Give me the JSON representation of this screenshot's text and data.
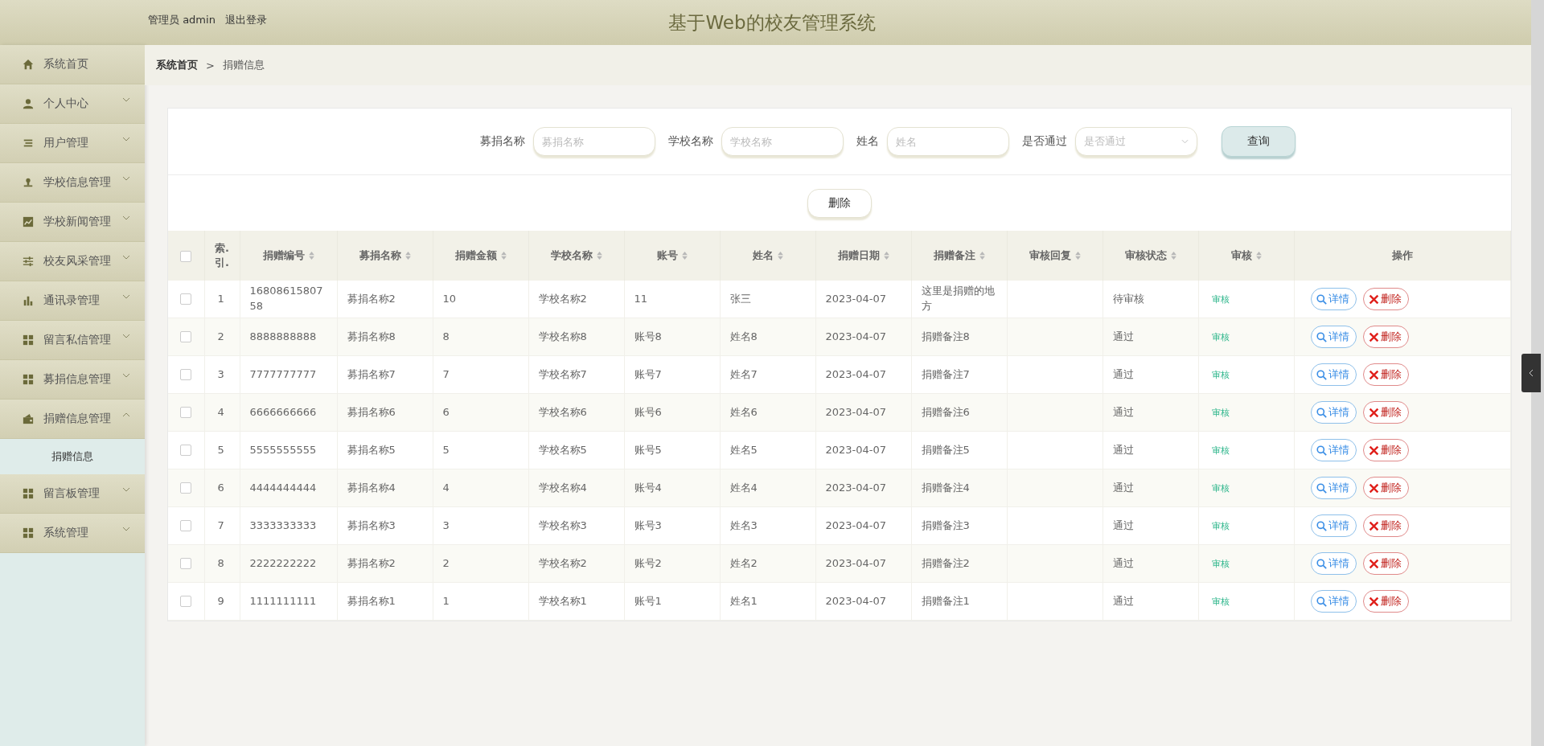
{
  "header": {
    "user_label": "管理员 admin",
    "logout": "退出登录",
    "title": "基于Web的校友管理系统"
  },
  "sidebar": {
    "items": [
      {
        "label": "系统首页"
      },
      {
        "label": "个人中心",
        "expanded": false
      },
      {
        "label": "用户管理",
        "expanded": false
      },
      {
        "label": "学校信息管理",
        "expanded": false
      },
      {
        "label": "学校新闻管理",
        "expanded": false
      },
      {
        "label": "校友风采管理",
        "expanded": false
      },
      {
        "label": "通讯录管理",
        "expanded": false
      },
      {
        "label": "留言私信管理",
        "expanded": false
      },
      {
        "label": "募捐信息管理",
        "expanded": false
      },
      {
        "label": "捐赠信息管理",
        "expanded": true,
        "children": [
          {
            "label": "捐赠信息"
          }
        ]
      },
      {
        "label": "留言板管理",
        "expanded": false
      },
      {
        "label": "系统管理",
        "expanded": false
      }
    ]
  },
  "breadcrumb": [
    "系统首页",
    ">",
    "捐赠信息"
  ],
  "search": {
    "fields": [
      {
        "label": "募捐名称",
        "placeholder": "募捐名称",
        "kind": "input"
      },
      {
        "label": "学校名称",
        "placeholder": "学校名称",
        "kind": "input"
      },
      {
        "label": "姓名",
        "placeholder": "姓名",
        "kind": "input"
      },
      {
        "label": "是否通过",
        "placeholder": "是否通过",
        "kind": "select"
      }
    ],
    "button": "查询"
  },
  "bulk_delete": "删除",
  "table": {
    "all_checked": false,
    "columns": [
      {
        "label": "索.\n引.",
        "sortable": false
      },
      {
        "label": "捐赠编号",
        "sortable": true
      },
      {
        "label": "募捐名称",
        "sortable": true
      },
      {
        "label": "捐赠金额",
        "sortable": true
      },
      {
        "label": "学校名称",
        "sortable": true
      },
      {
        "label": "账号",
        "sortable": true
      },
      {
        "label": "姓名",
        "sortable": true
      },
      {
        "label": "捐赠日期",
        "sortable": true
      },
      {
        "label": "捐赠备注",
        "sortable": true
      },
      {
        "label": "审核回复",
        "sortable": true
      },
      {
        "label": "审核状态",
        "sortable": true
      },
      {
        "label": "审核",
        "sortable": true
      },
      {
        "label": "操作",
        "sortable": false
      }
    ],
    "rows": [
      {
        "checked": false,
        "cells": [
          "1",
          "1680861580758",
          "募捐名称2",
          "10",
          "学校名称2",
          "11",
          "张三",
          "2023-04-07",
          "这里是捐赠的地方",
          "",
          "待审核"
        ],
        "review": "审核",
        "actions": [
          "详情",
          "删除"
        ]
      },
      {
        "checked": false,
        "cells": [
          "2",
          "8888888888",
          "募捐名称8",
          "8",
          "学校名称8",
          "账号8",
          "姓名8",
          "2023-04-07",
          "捐赠备注8",
          "",
          "通过"
        ],
        "review": "审核",
        "actions": [
          "详情",
          "删除"
        ]
      },
      {
        "checked": false,
        "cells": [
          "3",
          "7777777777",
          "募捐名称7",
          "7",
          "学校名称7",
          "账号7",
          "姓名7",
          "2023-04-07",
          "捐赠备注7",
          "",
          "通过"
        ],
        "review": "审核",
        "actions": [
          "详情",
          "删除"
        ]
      },
      {
        "checked": false,
        "cells": [
          "4",
          "6666666666",
          "募捐名称6",
          "6",
          "学校名称6",
          "账号6",
          "姓名6",
          "2023-04-07",
          "捐赠备注6",
          "",
          "通过"
        ],
        "review": "审核",
        "actions": [
          "详情",
          "删除"
        ]
      },
      {
        "checked": false,
        "cells": [
          "5",
          "5555555555",
          "募捐名称5",
          "5",
          "学校名称5",
          "账号5",
          "姓名5",
          "2023-04-07",
          "捐赠备注5",
          "",
          "通过"
        ],
        "review": "审核",
        "actions": [
          "详情",
          "删除"
        ]
      },
      {
        "checked": false,
        "cells": [
          "6",
          "4444444444",
          "募捐名称4",
          "4",
          "学校名称4",
          "账号4",
          "姓名4",
          "2023-04-07",
          "捐赠备注4",
          "",
          "通过"
        ],
        "review": "审核",
        "actions": [
          "详情",
          "删除"
        ]
      },
      {
        "checked": false,
        "cells": [
          "7",
          "3333333333",
          "募捐名称3",
          "3",
          "学校名称3",
          "账号3",
          "姓名3",
          "2023-04-07",
          "捐赠备注3",
          "",
          "通过"
        ],
        "review": "审核",
        "actions": [
          "详情",
          "删除"
        ]
      },
      {
        "checked": false,
        "cells": [
          "8",
          "2222222222",
          "募捐名称2",
          "2",
          "学校名称2",
          "账号2",
          "姓名2",
          "2023-04-07",
          "捐赠备注2",
          "",
          "通过"
        ],
        "review": "审核",
        "actions": [
          "详情",
          "删除"
        ]
      },
      {
        "checked": false,
        "cells": [
          "9",
          "1111111111",
          "募捐名称1",
          "1",
          "学校名称1",
          "账号1",
          "姓名1",
          "2023-04-07",
          "捐赠备注1",
          "",
          "通过"
        ],
        "review": "审核",
        "actions": [
          "详情",
          "删除"
        ]
      }
    ]
  }
}
